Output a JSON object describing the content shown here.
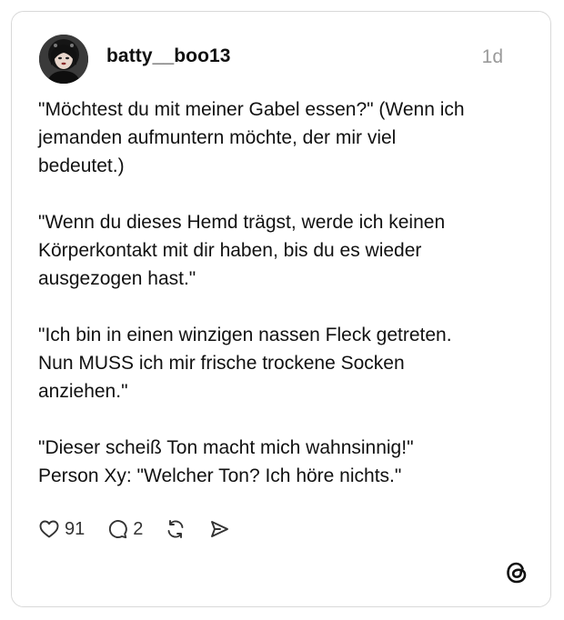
{
  "post": {
    "username": "batty__boo13",
    "time": "1d",
    "paragraphs": [
      "\"Möchtest du mit meiner Gabel essen?\" (Wenn ich\njemanden aufmuntern möchte, der mir viel\nbedeutet.)",
      "\"Wenn du dieses Hemd trägst, werde ich keinen\nKörperkontakt mit dir haben, bis du es wieder\nausgezogen hast.\"",
      "\"Ich bin in einen winzigen nassen Fleck getreten.\nNun MUSS ich mir frische trockene Socken\nanziehen.\"",
      "\"Dieser scheiß Ton macht mich wahnsinnig!\"\nPerson Xy: \"Welcher Ton? Ich höre nichts.\""
    ]
  },
  "actions": {
    "likes": "91",
    "comments": "2",
    "like_icon": "heart-icon",
    "comment_icon": "comment-bubble-icon",
    "repost_icon": "repost-icon",
    "share_icon": "send-icon"
  },
  "branding": {
    "logo_icon": "threads-logo-icon"
  },
  "colors": {
    "text": "#111111",
    "muted": "#9a9a9a",
    "border": "#d9d9d9"
  }
}
